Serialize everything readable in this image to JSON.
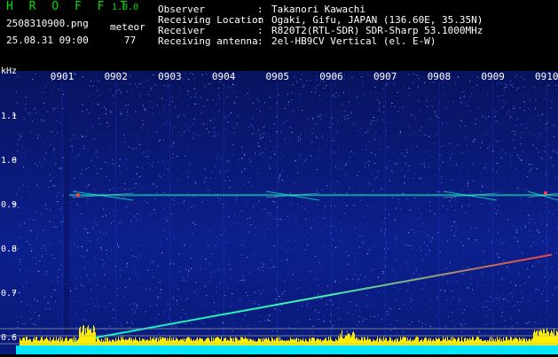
{
  "app": {
    "name": "H R O F F T",
    "version": "1.0.0"
  },
  "file": {
    "name": "2508310900.png",
    "datetime": "25.08.31 09:00"
  },
  "meteor": {
    "label": "meteor",
    "count": "77"
  },
  "info": [
    {
      "label": "Observer",
      "value": "Takanori Kawachi"
    },
    {
      "label": "Receiving Location",
      "value": "Ogaki, Gifu, JAPAN (136.60E, 35.35N)"
    },
    {
      "label": "Receiver",
      "value": "R820T2(RTL-SDR) SDR-Sharp 53.1000MHz"
    },
    {
      "label": "Receiving antenna",
      "value": "2el-HB9CV Vertical (el. E-W)"
    }
  ],
  "spectrogram": {
    "unit": "kHz",
    "y_ticks": [
      "1.1",
      "1.0",
      "0.9",
      "0.8",
      "0.7",
      "0.6"
    ],
    "time_labels": [
      "0901",
      "0902",
      "0903",
      "0904",
      "0905",
      "0906",
      "0907",
      "0908",
      "0909",
      "0910"
    ],
    "colors": {
      "background": "#0a1a7a",
      "noise": "#3a5cff",
      "signal": "#00ffd0",
      "hot": "#ff3030",
      "level": "#00e5ff",
      "peak": "#ffee00"
    }
  }
}
